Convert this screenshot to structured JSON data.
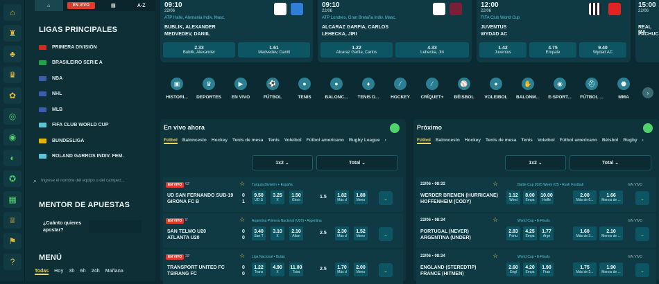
{
  "side_tabs": [
    "⌂",
    "EN VIVO",
    "▤",
    "A-Z"
  ],
  "ligas_title": "LIGAS PRINCIPALES",
  "leagues": [
    {
      "name": "PRIMERA DIVISIÓN",
      "color": "#d52b1e"
    },
    {
      "name": "BRASILEIRO SERIE A",
      "color": "#1fa347"
    },
    {
      "name": "NBA",
      "color": "#3c5cae"
    },
    {
      "name": "NHL",
      "color": "#3c5cae"
    },
    {
      "name": "MLB",
      "color": "#3c5cae"
    },
    {
      "name": "FIFA CLUB WORLD CUP",
      "color": "#59c6d7"
    },
    {
      "name": "BUNDESLIGA",
      "color": "#e0b400"
    },
    {
      "name": "ROLAND GARROS INDIV. FEM.",
      "color": "#59c6d7"
    }
  ],
  "search_placeholder": "Ingrese el nombre del equipo o del campeo...",
  "mentor_title": "MENTOR DE APUESTAS",
  "mentor_question": "¿Cuánto quieres apostar?",
  "menu_title": "MENÚ",
  "menu_tabs": [
    "Todas",
    "Hoy",
    "3h",
    "6h",
    "24h",
    "Mañana"
  ],
  "top_matches": [
    {
      "time": "09:10",
      "date": "22/06",
      "league": "ATP Halle, Alemania Indiv. Masc.",
      "t1": "BUBLIK, ALEXANDER",
      "t2": "MEDVEDEV, DANIIL",
      "o": [
        [
          "2.33",
          "Bublik, Alexander"
        ],
        [
          "1.61",
          "Medvedev, Daniil"
        ]
      ]
    },
    {
      "time": "09:10",
      "date": "22/06",
      "league": "ATP Londres, Gran Bretaña Indiv. Masc.",
      "t1": "ALCARAZ GARFIA, CARLOS",
      "t2": "LEHECKA, JIRI",
      "o": [
        [
          "1.22",
          "Alcaraz Garfia, Carlos"
        ],
        [
          "4.33",
          "Lehecka, Jiri"
        ]
      ]
    },
    {
      "time": "12:00",
      "date": "22/06",
      "league": "FIFA Club World Cup",
      "t1": "JUVENTUS",
      "t2": "WYDAD AC",
      "o": [
        [
          "1.42",
          "Juventus"
        ],
        [
          "4.75",
          "Empate"
        ],
        [
          "9.40",
          "Wydad AC"
        ]
      ]
    },
    {
      "time": "15:00",
      "date": "22/06",
      "league": "",
      "t1": "REAL MA",
      "t2": "PACHUC",
      "o": []
    }
  ],
  "sports": [
    "HISTORI...",
    "DEPORTES",
    "EN VIVO",
    "FÚTBOL",
    "TENIS",
    "BALONC...",
    "TENIS D...",
    "HOCKEY",
    "CRÍQUET+",
    "BÉISBOL",
    "VOLEIBOL",
    "BALONM...",
    "E-SPORT...",
    "FÚTBOL ...",
    "MMA"
  ],
  "sport_icons": [
    "▣",
    "♛",
    "▶",
    "⚽",
    "●",
    "●",
    "♦",
    "⁄",
    "⁄",
    "⚾",
    "●",
    "✋",
    "◉",
    "⛑",
    "⬣"
  ],
  "live": {
    "title": "En vivo ahora",
    "tabs": [
      "Fútbol",
      "Baloncesto",
      "Hockey",
      "Tenis de mesa",
      "Tenis",
      "Voleibol",
      "Fútbol americano",
      "Rugby League"
    ],
    "dd1": "1x2",
    "dd2": "Total",
    "rows": [
      {
        "badge": "EN VIVO",
        "min": "62'",
        "league": "Turquía División + España",
        "t1": "UD SAN FERNANDO SUB-19",
        "t2": "GIRONA FC B",
        "s1": "0",
        "s2": "1",
        "o1": [
          "9.50",
          "UD S"
        ],
        "ox": [
          "3.25",
          "X"
        ],
        "o2": [
          "1.50",
          "Giron"
        ],
        "line": "1.5",
        "ov": [
          "1.82",
          "Más d"
        ],
        "un": [
          "1.88",
          "Meno"
        ]
      },
      {
        "badge": "EN VIVO",
        "min": "5'",
        "league": "Argentina Primera Nacional (U20) • Argentina",
        "t1": "SAN TELMO U20",
        "t2": "ATLANTA U20",
        "s1": "0",
        "s2": "0",
        "o1": [
          "3.40",
          "San T"
        ],
        "ox": [
          "3.10",
          "X"
        ],
        "o2": [
          "2.10",
          "Atlan"
        ],
        "line": "2.5",
        "ov": [
          "2.30",
          "Más d"
        ],
        "un": [
          "1.52",
          "Meno"
        ]
      },
      {
        "badge": "EN VIVO",
        "min": "29'",
        "league": "Liga Nacional • Bután",
        "t1": "TRANSPORT UNITED FC",
        "t2": "TSIRANG FC",
        "s1": "0",
        "s2": "0",
        "o1": [
          "1.22",
          "Trans"
        ],
        "ox": [
          "4.90",
          "X"
        ],
        "o2": [
          "11.00",
          "Tsira"
        ],
        "line": "2.5",
        "ov": [
          "1.70",
          "Más d"
        ],
        "un": [
          "2.00",
          "Meno"
        ]
      }
    ]
  },
  "next": {
    "title": "Próximo",
    "tabs": [
      "Fútbol",
      "Baloncesto",
      "Hockey",
      "Tenis de mesa",
      "Tenis",
      "Voleibol",
      "Fútbol americano",
      "Béisbol",
      "Rugby"
    ],
    "dd1": "1x2",
    "dd2": "Total",
    "rows": [
      {
        "date": "22/06 • 08:32",
        "league": "Battle Cup 2025 Week #25 • Rush Football",
        "t1": "WERDER BREMEN (HURRICANE)",
        "t2": "HOFFENHEIM (CODY)",
        "o1": [
          "1.12",
          "Werd"
        ],
        "ox": [
          "8.00",
          "Empa"
        ],
        "o2": [
          "10.00",
          "Hoffe"
        ],
        "ov": [
          "2.00",
          "Más de 6..."
        ],
        "un": [
          "1.66",
          "Menos de ..."
        ]
      },
      {
        "date": "22/06 • 08:34",
        "league": "World Cup • E-Rivals",
        "t1": "PORTUGAL (NEVER)",
        "t2": "ARGENTINA (UNDER)",
        "o1": [
          "2.83",
          "Portu"
        ],
        "ox": [
          "4.25",
          "Empa"
        ],
        "o2": [
          "1.77",
          "Arge"
        ],
        "ov": [
          "1.60",
          "Más de 3..."
        ],
        "un": [
          "2.10",
          "Menos de ..."
        ]
      },
      {
        "date": "22/06 • 08:34",
        "league": "World Cup • E-Rivals",
        "t1": "ENGLAND (STEREDTIP)",
        "t2": "FRANCE (HITMEN)",
        "o1": [
          "2.60",
          "Engl"
        ],
        "ox": [
          "4.20",
          "Empa"
        ],
        "o2": [
          "1.90",
          "Fran"
        ],
        "ov": [
          "1.75",
          "Más de 3..."
        ],
        "un": [
          "1.90",
          "Menos de ..."
        ]
      }
    ],
    "badge": "EN VIVO"
  }
}
